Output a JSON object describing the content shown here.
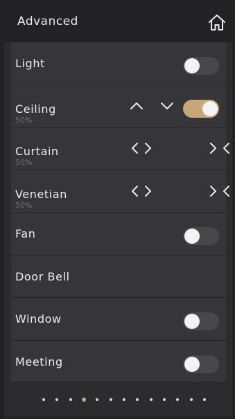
{
  "header": {
    "title": "Advanced",
    "home_icon": "home-icon"
  },
  "rows": [
    {
      "label": "Light",
      "control": "toggle",
      "on": false
    },
    {
      "label": "Ceiling",
      "sub": "50%",
      "control": "up-down-toggle",
      "on": true
    },
    {
      "label": "Curtain",
      "sub": "50%",
      "control": "open-close"
    },
    {
      "label": "Venetian",
      "sub": "50%",
      "control": "open-close"
    },
    {
      "label": "Fan",
      "control": "toggle",
      "on": false
    },
    {
      "label": "Door Bell",
      "control": "none"
    },
    {
      "label": "Window",
      "control": "toggle",
      "on": false
    },
    {
      "label": "Meeting",
      "control": "toggle",
      "on": false
    }
  ],
  "pager": {
    "count": 13,
    "active_index": 3
  },
  "colors": {
    "accent": "#c8a67c",
    "row_bg": "#363538",
    "header_bg": "#232225"
  }
}
